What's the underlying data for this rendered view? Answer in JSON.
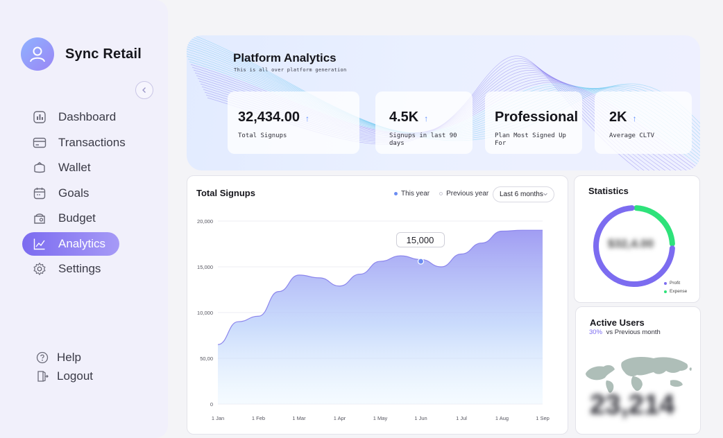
{
  "brand": {
    "name": "Sync Retail"
  },
  "nav": {
    "items": [
      {
        "label": "Dashboard",
        "icon": "dashboard-icon"
      },
      {
        "label": "Transactions",
        "icon": "card-icon"
      },
      {
        "label": "Wallet",
        "icon": "wallet-icon"
      },
      {
        "label": "Goals",
        "icon": "calendar-icon"
      },
      {
        "label": "Budget",
        "icon": "budget-icon"
      },
      {
        "label": "Analytics",
        "icon": "chart-icon",
        "active": true
      },
      {
        "label": "Settings",
        "icon": "gear-icon"
      }
    ],
    "help_label": "Help",
    "logout_label": "Logout"
  },
  "hero": {
    "title": "Platform Analytics",
    "subtitle": "This is all over platform generation",
    "stats": [
      {
        "value": "32,434.00",
        "label": "Total Signups",
        "trend": "↑"
      },
      {
        "value": "4.5K",
        "label": "Signups in last 90 days",
        "trend": "↑"
      },
      {
        "value": "Professional",
        "label": "Plan Most Signed Up For",
        "trend": ""
      },
      {
        "value": "2K",
        "label": "Average CLTV",
        "trend": "↑"
      }
    ]
  },
  "signups": {
    "title": "Total Signups",
    "legend_this_year": "This year",
    "legend_previous_year": "Previous year",
    "range": "Last 6 months",
    "tooltip": "15,000"
  },
  "colors": {
    "accent": "#7c6cf0",
    "line": "#8b85ec",
    "profit": "#7c6cf0",
    "expense": "#2ee27a"
  },
  "chart_data": {
    "type": "area",
    "x_labels": [
      "1 Jan",
      "1 Feb",
      "1 Mar",
      "1 Apr",
      "1 May",
      "1 Jun",
      "1 Jul",
      "1 Aug",
      "1 Sep"
    ],
    "y_ticks": [
      "20,000",
      "15,000",
      "10,000",
      "50,00",
      "0"
    ],
    "ylim": [
      0,
      20000
    ],
    "x": [
      0,
      0.5,
      1,
      1.5,
      2,
      2.5,
      3,
      3.5,
      4,
      4.5,
      5,
      5.5,
      6,
      6.5,
      7,
      7.5,
      8
    ],
    "values": [
      6500,
      9000,
      9600,
      12300,
      14100,
      13800,
      12900,
      14200,
      15600,
      16200,
      15800,
      15000,
      16400,
      17600,
      18900,
      19000,
      19000
    ],
    "highlight": {
      "x": 5,
      "value": 15600,
      "label": "15,000"
    },
    "series": [
      {
        "name": "This year"
      }
    ]
  },
  "statistics": {
    "title": "Statistics",
    "center_value": "$32,4.00",
    "legend": [
      {
        "label": "Profit",
        "color": "#7c6cf0",
        "share": 0.75
      },
      {
        "label": "Expense",
        "color": "#2ee27a",
        "share": 0.25
      }
    ]
  },
  "active_users": {
    "title": "Active Users",
    "change": "30%",
    "change_label": "vs Previous month",
    "count": "23,214"
  }
}
